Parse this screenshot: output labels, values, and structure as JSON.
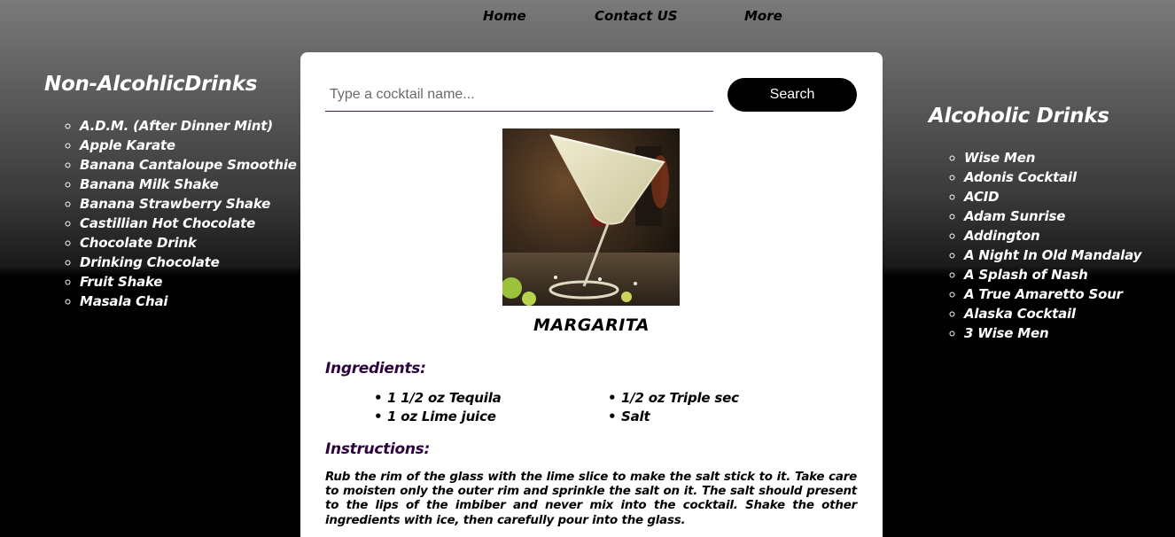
{
  "nav": {
    "home": "Home",
    "contact": "Contact US",
    "more": "More"
  },
  "left_sidebar": {
    "title": "Non-AlcohlicDrinks",
    "items": [
      "A.D.M. (After Dinner Mint)",
      "Apple Karate",
      "Banana Cantaloupe Smoothie",
      "Banana Milk Shake",
      "Banana Strawberry Shake",
      "Castillian Hot Chocolate",
      "Chocolate Drink",
      "Drinking Chocolate",
      "Fruit Shake",
      "Masala Chai"
    ]
  },
  "right_sidebar": {
    "title": "Alcoholic Drinks",
    "items": [
      "Wise Men",
      "Adonis Cocktail",
      "ACID",
      "Adam Sunrise",
      "Addington",
      "A Night In Old Mandalay",
      "A Splash of Nash",
      "A True Amaretto Sour",
      "Alaska Cocktail",
      "3 Wise Men"
    ]
  },
  "search": {
    "placeholder": "Type a cocktail name...",
    "value": "",
    "button_label": "Search"
  },
  "drink": {
    "image_icon": "cocktail-glass-photo",
    "name": "MARGARITA",
    "ingredients_title": "Ingredients:",
    "ingredients": [
      "1 1/2 oz Tequila",
      "1/2 oz Triple sec",
      "1 oz Lime juice",
      "Salt"
    ],
    "instructions_title": "Instructions:",
    "instructions": "Rub the rim of the glass with the lime slice to make the salt stick to it. Take care to moisten only the outer rim and sprinkle the salt on it. The salt should present to the lips of the imbiber and never mix into the cocktail. Shake the other ingredients with ice, then carefully pour into the glass."
  },
  "colors": {
    "accent_heading": "#2d0440",
    "button_bg": "#000000",
    "card_bg": "#ffffff"
  }
}
